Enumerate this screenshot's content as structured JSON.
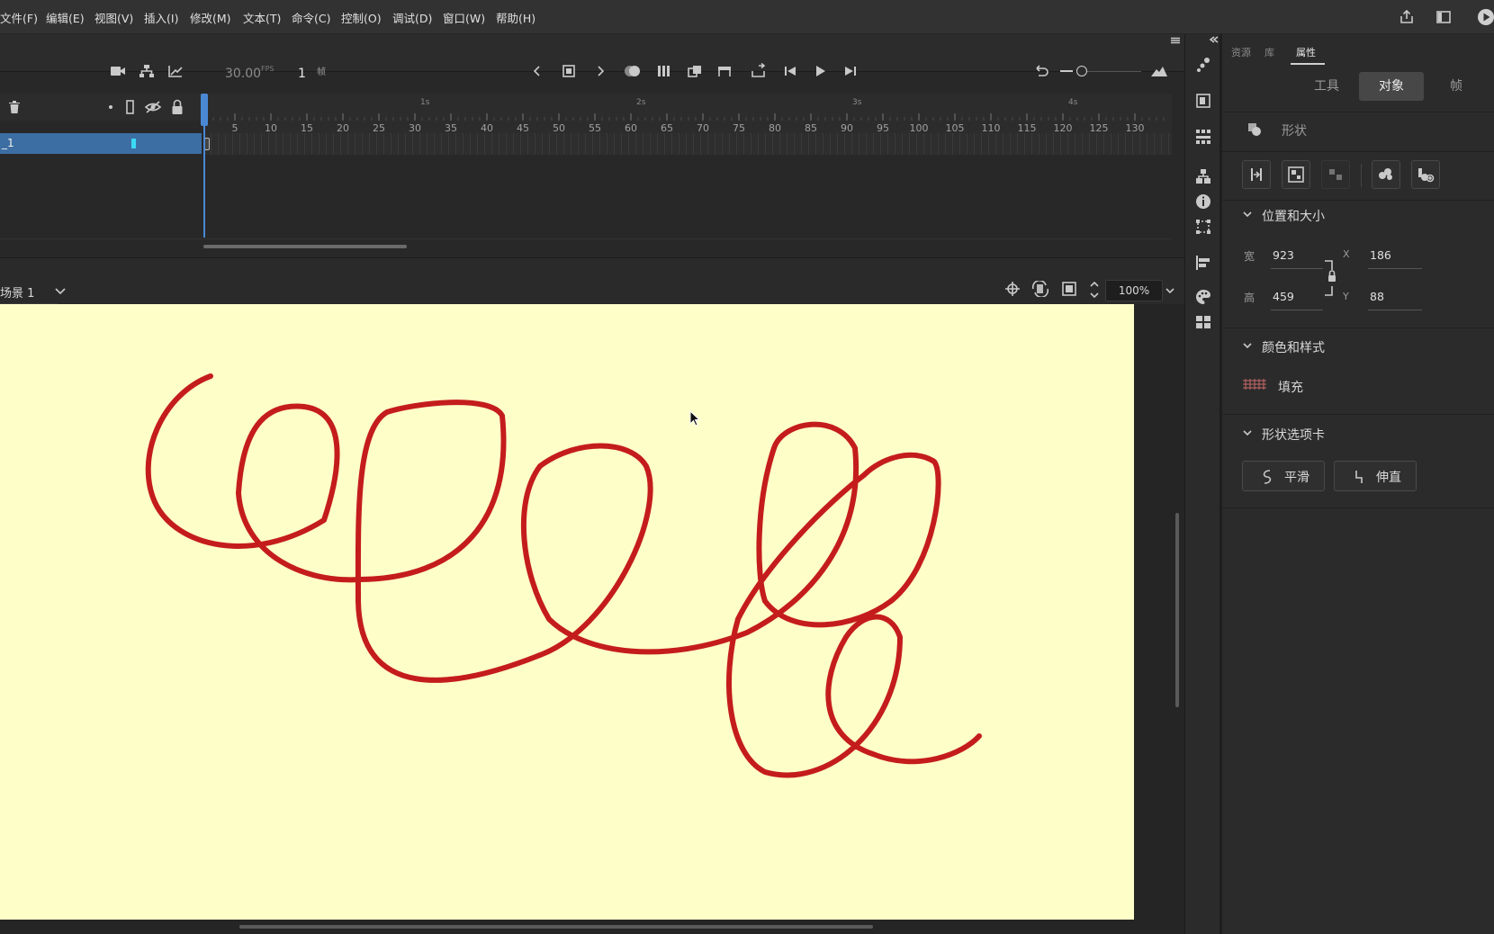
{
  "menu": [
    "文件(F)",
    "编辑(E)",
    "视图(V)",
    "插入(I)",
    "修改(M)",
    "文本(T)",
    "命令(C)",
    "控制(O)",
    "调试(D)",
    "窗口(W)",
    "帮助(H)"
  ],
  "timeline": {
    "fps_value": "30.00",
    "fps_unit": "FPS",
    "frame_value": "1",
    "frame_unit": "帧",
    "layer_name": "_1",
    "seconds": [
      "1s",
      "2s",
      "3s",
      "4s"
    ],
    "frame_ticks": [
      "5",
      "10",
      "15",
      "20",
      "25",
      "30",
      "35",
      "40",
      "45",
      "50",
      "55",
      "60",
      "65",
      "70",
      "75",
      "80",
      "85",
      "90",
      "95",
      "100",
      "105",
      "110",
      "115",
      "120",
      "125",
      "130"
    ]
  },
  "stage": {
    "scene": "场景 1",
    "zoom": "100%",
    "background_color": "#fefec9",
    "stroke_color": "#c41c1c"
  },
  "panel": {
    "tabs": [
      "资源",
      "库",
      "属性"
    ],
    "segments": [
      "工具",
      "对象",
      "帧"
    ],
    "object_type": "形状",
    "position_size": {
      "title": "位置和大小",
      "width_label": "宽",
      "width_value": "923",
      "height_label": "高",
      "height_value": "459",
      "x_label": "X",
      "x_value": "186",
      "y_label": "Y",
      "y_value": "88"
    },
    "color_style": {
      "title": "颜色和样式",
      "fill_label": "填充"
    },
    "shape_options": {
      "title": "形状选项卡",
      "smooth_label": "平滑",
      "straighten_label": "伸直"
    }
  }
}
